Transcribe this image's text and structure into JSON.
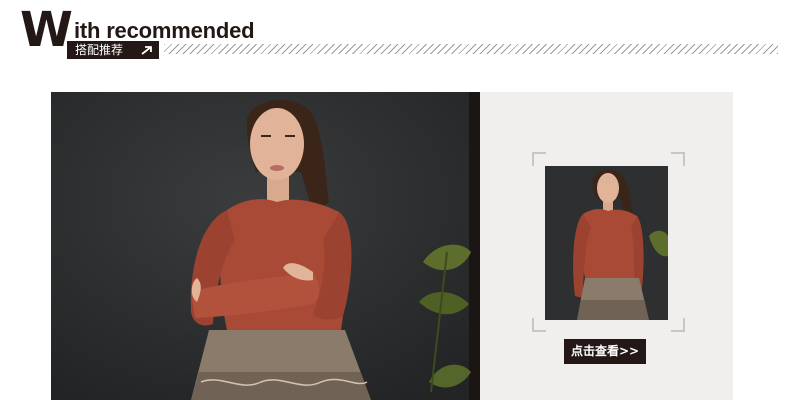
{
  "header": {
    "title_initial": "W",
    "title_rest": "ith recommended",
    "subtitle": "搭配推荐"
  },
  "recommend": {
    "cta_label": "点击查看>>"
  },
  "colors": {
    "dark": "#231815",
    "panel_bg": "#f0efed",
    "wall": "#2d2f30",
    "sweater": "#a84a36",
    "skirt": "#8a7b6a",
    "plant": "#5d6e2c"
  },
  "icons": {
    "subtitle_arrow": "arrow-icon"
  }
}
